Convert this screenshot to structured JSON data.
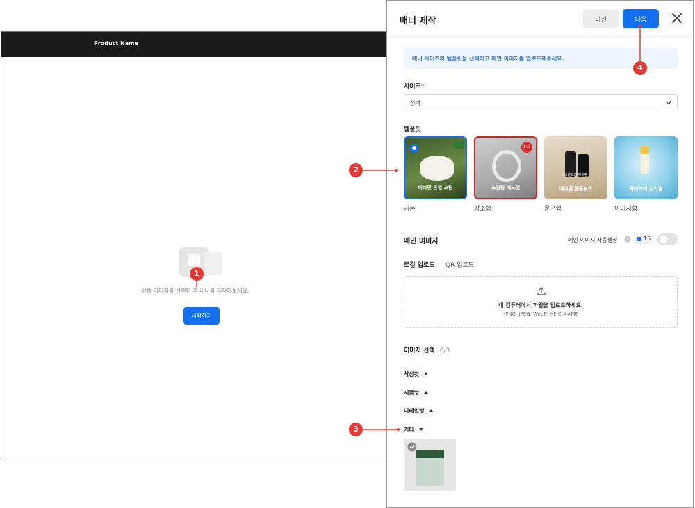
{
  "background": {
    "product_name": "Product Name",
    "empty_message": "상품 이미지를 선택한 후 배너를 제작해보세요.",
    "start_button": "시작하기"
  },
  "panel": {
    "title": "배너 제작",
    "prev_button": "이전",
    "next_button": "다음",
    "info_text": "배너 사이즈와 템플릿을 선택하고 메인 이미지를 업로드해주세요.",
    "size": {
      "label": "사이즈",
      "required_mark": "*",
      "value": "선택"
    },
    "template": {
      "label": "템플릿",
      "items": [
        {
          "name": "기본",
          "inner_label": "비타민 톤업 크림",
          "selected": true
        },
        {
          "name": "강조형",
          "inner_label": "초경량 헤드셋",
          "badge": "1+1"
        },
        {
          "name": "문구형",
          "inner_label": "에나멜 첼플부츠",
          "caption": "브랜드명 아이템"
        },
        {
          "name": "이미지형",
          "inner_label": "차데프리 선크림"
        }
      ]
    },
    "main_image": {
      "label": "메인 이미지",
      "auto_label": "메인 이미지 자동생성",
      "credit": "15",
      "toggle_on": false
    },
    "upload": {
      "tab_local": "로컬 업로드",
      "tab_qr": "QR 업로드",
      "title": "내 컴퓨터에서 파일을 업로드하세요.",
      "formats": "*PNG, JPEG, WebP, HEIC  ##MB"
    },
    "image_select": {
      "label": "이미지 선택",
      "count": "0/3",
      "categories": [
        "착장컷",
        "제품컷",
        "디테일컷",
        "기타"
      ]
    }
  },
  "callouts": [
    "1",
    "2",
    "3",
    "4"
  ],
  "colors": {
    "primary": "#1570ef",
    "callout": "#e53935",
    "dark_header": "#1b1b1b"
  }
}
